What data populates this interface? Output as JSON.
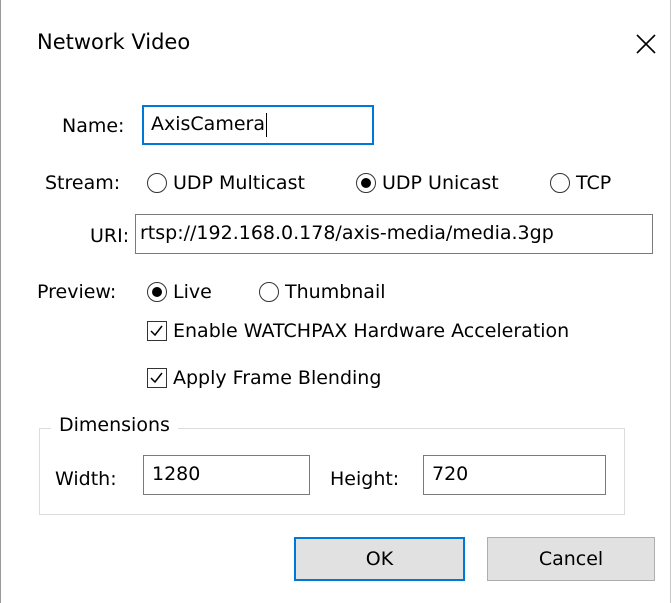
{
  "dialog": {
    "title": "Network Video"
  },
  "name": {
    "label": "Name:",
    "value": "AxisCamera"
  },
  "stream": {
    "label": "Stream:",
    "options": [
      "UDP Multicast",
      "UDP Unicast",
      "TCP"
    ],
    "selected": "UDP Unicast"
  },
  "uri": {
    "label": "URI:",
    "value": "rtsp://192.168.0.178/axis-media/media.3gp"
  },
  "preview": {
    "label": "Preview:",
    "options": [
      "Live",
      "Thumbnail"
    ],
    "selected": "Live"
  },
  "options": {
    "hw_accel_label": "Enable WATCHPAX Hardware Acceleration",
    "hw_accel_checked": true,
    "frame_blending_label": "Apply Frame Blending",
    "frame_blending_checked": true
  },
  "dimensions": {
    "legend": "Dimensions",
    "width_label": "Width:",
    "width_value": "1280",
    "height_label": "Height:",
    "height_value": "720"
  },
  "buttons": {
    "ok": "OK",
    "cancel": "Cancel"
  },
  "colors": {
    "accent": "#0078d7",
    "button_bg": "#e1e1e1"
  },
  "icons": {
    "close": "close-icon",
    "check": "checkmark-icon"
  }
}
